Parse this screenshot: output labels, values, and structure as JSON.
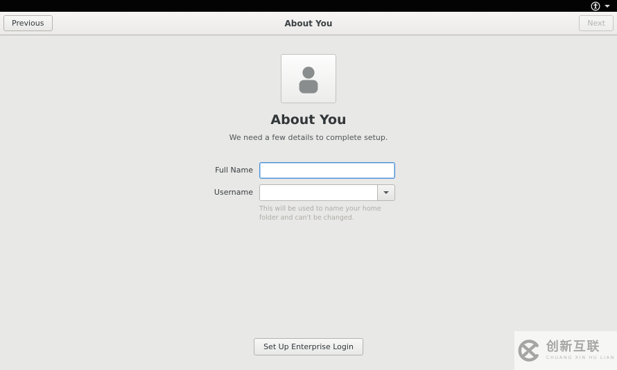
{
  "topbar": {
    "status_caret": ""
  },
  "header": {
    "previous_label": "Previous",
    "title": "About You",
    "next_label": "Next"
  },
  "main": {
    "heading": "About You",
    "subtitle": "We need a few details to complete setup.",
    "form": {
      "full_name_label": "Full Name",
      "full_name_value": "",
      "username_label": "Username",
      "username_value": "",
      "username_help": "This will be used to name your home folder and can't be changed."
    },
    "enterprise_login_label": "Set Up Enterprise Login"
  },
  "watermark": {
    "cn": "创新互联",
    "en": "CHUANG XIN HU LIAN"
  },
  "colors": {
    "focus_blue": "#4a90d9",
    "topbar_bg": "#030303",
    "page_bg": "#e8e8e6"
  }
}
